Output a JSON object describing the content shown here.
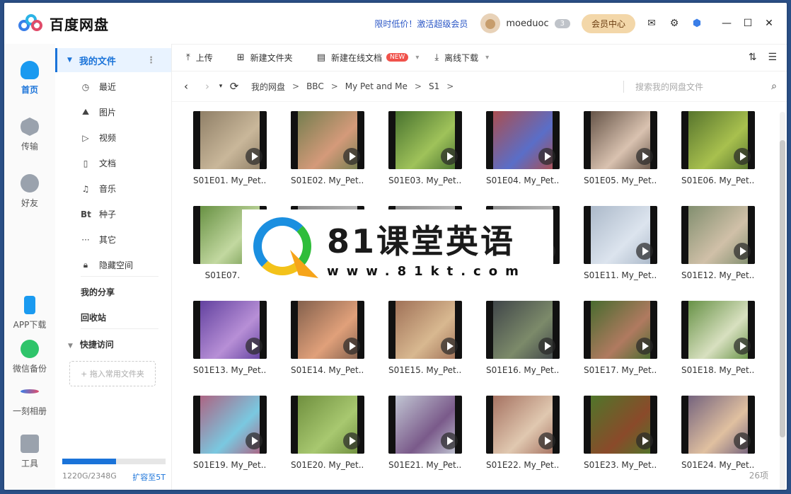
{
  "app": {
    "name": "百度网盘",
    "promo": "限时低价！激活超级会员",
    "username": "moeduoc",
    "level": "3",
    "vip_button": "会员中心"
  },
  "colors": {
    "accent": "#1a73d9",
    "badge": "#f0524b",
    "vip": "#f3d7a9"
  },
  "left_nav": [
    {
      "label": "首页",
      "icon": "cloud-icon",
      "active": true
    },
    {
      "label": "传输",
      "icon": "transfer-icon"
    },
    {
      "label": "好友",
      "icon": "friends-icon"
    },
    {
      "label": "APP下载",
      "icon": "phone-icon"
    },
    {
      "label": "微信备份",
      "icon": "wechat-icon"
    },
    {
      "label": "一刻相册",
      "icon": "album-icon"
    },
    {
      "label": "工具",
      "icon": "tools-icon"
    }
  ],
  "sidebar": {
    "my_files": "我的文件",
    "items": [
      {
        "label": "最近",
        "icon": "clock-icon"
      },
      {
        "label": "图片",
        "icon": "image-icon"
      },
      {
        "label": "视频",
        "icon": "video-icon"
      },
      {
        "label": "文档",
        "icon": "document-icon"
      },
      {
        "label": "音乐",
        "icon": "music-icon"
      },
      {
        "label": "种子",
        "icon": "torrent-icon"
      },
      {
        "label": "其它",
        "icon": "more-icon"
      },
      {
        "label": "隐藏空间",
        "icon": "lock-icon"
      }
    ],
    "my_share": "我的分享",
    "recycle": "回收站",
    "quick_access": "快捷访问",
    "drag_hint": "+ 拖入常用文件夹",
    "storage_text": "1220G/2348G",
    "storage_fraction": 0.52,
    "expand": "扩容至5T"
  },
  "toolbar": {
    "upload": "上传",
    "new_folder": "新建文件夹",
    "new_doc": "新建在线文档",
    "new_badge": "NEW",
    "offline": "离线下载"
  },
  "path": {
    "crumbs": [
      "我的网盘",
      "BBC",
      "My Pet and Me",
      "S1"
    ],
    "search_placeholder": "搜索我的网盘文件"
  },
  "files": [
    "S01E01. My_Pet...",
    "S01E02. My_Pet...",
    "S01E03. My_Pet...",
    "S01E04. My_Pet...",
    "S01E05. My_Pet...",
    "S01E06. My_Pet...",
    "S01E07. My",
    "",
    "",
    "",
    "S01E11. My_Pet...",
    "S01E12. My_Pet...",
    "S01E13. My_Pet...",
    "S01E14. My_Pet...",
    "S01E15. My_Pet...",
    "S01E16. My_Pet...",
    "S01E17. My_Pet...",
    "S01E18. My_Pet...",
    "S01E19. My_Pet...",
    "S01E20. My_Pet...",
    "S01E21. My_Pet...",
    "S01E22. My_Pet...",
    "S01E23. My_Pet...",
    "S01E24. My_Pet..."
  ],
  "item_count": "26项",
  "watermark": {
    "title": "81课堂英语",
    "url": "www.81kt.com"
  }
}
